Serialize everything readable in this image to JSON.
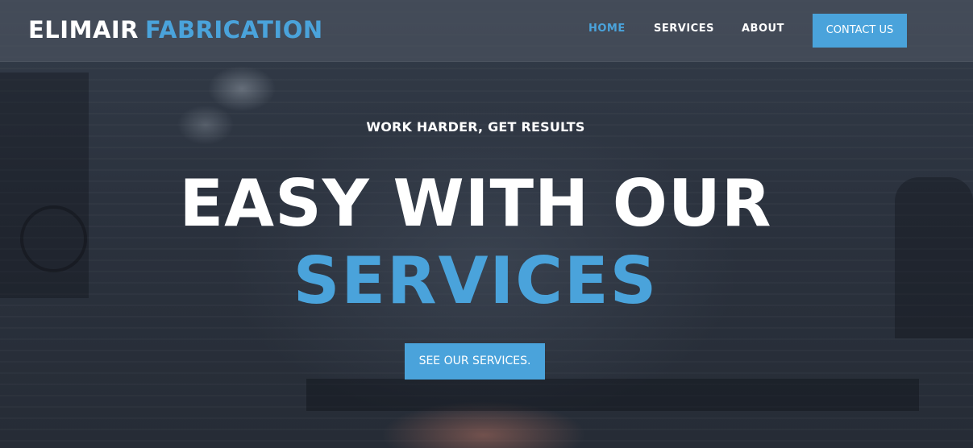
{
  "brand": {
    "name_part1": "ELIMAIR",
    "name_part2": "FABRICATION"
  },
  "nav": {
    "items": [
      {
        "label": "HOME",
        "active": true
      },
      {
        "label": "SERVICES",
        "active": false
      },
      {
        "label": "ABOUT",
        "active": false
      }
    ],
    "contact_label": "CONTACT US"
  },
  "hero": {
    "eyebrow": "WORK HARDER, GET RESULTS",
    "headline": "EASY WITH OUR",
    "headline_accent": "SERVICES",
    "cta_label": "SEE OUR SERVICES."
  },
  "colors": {
    "accent": "#4aa3db",
    "text": "#ffffff",
    "header_bg": "#48505c",
    "hero_bg": "#2a313d"
  }
}
